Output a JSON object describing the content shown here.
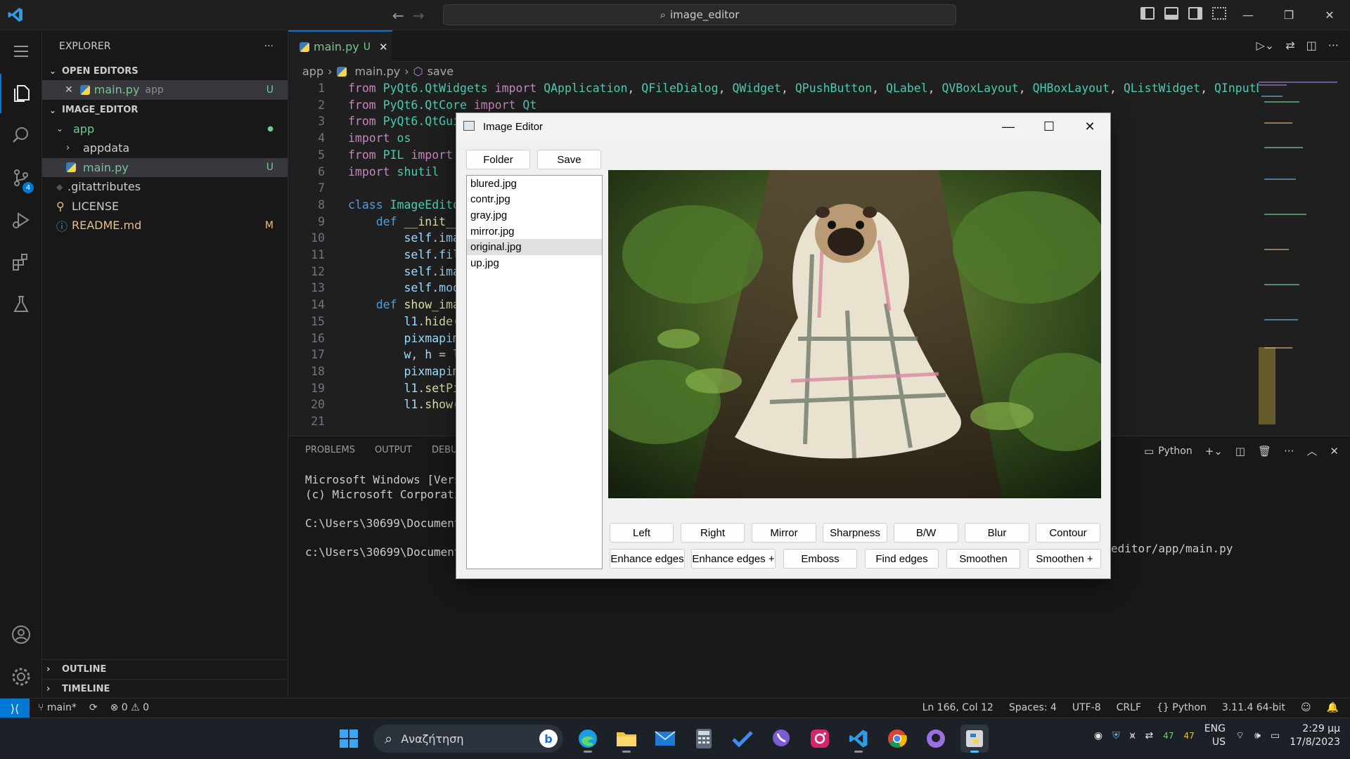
{
  "titlebar": {
    "search": "image_editor"
  },
  "sidebar": {
    "title": "EXPLORER",
    "open_editors_label": "OPEN EDITORS",
    "open_editor": {
      "name": "main.py",
      "folder": "app",
      "status": "U"
    },
    "workspace_label": "IMAGE_EDITOR",
    "tree": [
      {
        "name": "app",
        "status": "●"
      },
      {
        "name": "appdata",
        "status": ""
      },
      {
        "name": "main.py",
        "status": "U"
      },
      {
        "name": ".gitattributes",
        "status": ""
      },
      {
        "name": "LICENSE",
        "status": ""
      },
      {
        "name": "README.md",
        "status": "M"
      }
    ],
    "outline_label": "OUTLINE",
    "timeline_label": "TIMELINE"
  },
  "source_control_badge": "4",
  "editor": {
    "tab": {
      "name": "main.py",
      "status": "U"
    },
    "breadcrumb": [
      "app",
      "main.py",
      "save"
    ],
    "line_numbers": [
      "1",
      "2",
      "3",
      "4",
      "5",
      "6",
      "7",
      "8",
      "9",
      "10",
      "11",
      "12",
      "13",
      "14",
      "15",
      "16",
      "17",
      "18",
      "19",
      "20",
      "21"
    ]
  },
  "panel": {
    "tabs": [
      "PROBLEMS",
      "OUTPUT",
      "DEBU"
    ],
    "terminal_name": "Python",
    "terminal_lines": [
      "Microsoft Windows [Versi",
      "(c) Microsoft Corporatio",
      "",
      "C:\\Users\\30699\\Documents",
      "",
      "c:\\Users\\30699\\Documents"
    ],
    "terminal_tail": "editor/app/main.py"
  },
  "statusbar": {
    "branch": "main*",
    "errors": "0",
    "warnings": "0",
    "position": "Ln 166, Col 12",
    "spaces": "Spaces: 4",
    "encoding": "UTF-8",
    "eol": "CRLF",
    "language": "Python",
    "interpreter": "3.11.4 64-bit"
  },
  "taskbar": {
    "search_placeholder": "Αναζήτηση",
    "lang_line1": "ENG",
    "lang_line2": "US",
    "time": "2:29 μμ",
    "date": "17/8/2023",
    "temp1": "47",
    "temp2": "47"
  },
  "dialog": {
    "title": "Image Editor",
    "folder_btn": "Folder",
    "save_btn": "Save",
    "files": [
      "blured.jpg",
      "contr.jpg",
      "gray.jpg",
      "mirror.jpg",
      "original.jpg",
      "up.jpg"
    ],
    "selected_file": "original.jpg",
    "row1_buttons": [
      "Left",
      "Right",
      "Mirror",
      "Sharpness",
      "B/W",
      "Blur",
      "Contour"
    ],
    "row2_buttons": [
      "Enhance edges",
      "Enhance edges +",
      "Emboss",
      "Find edges",
      "Smoothen",
      "Smoothen +"
    ]
  },
  "colors": {
    "accent": "#0078d4",
    "untracked": "#73c991",
    "modified": "#e2c08d"
  }
}
